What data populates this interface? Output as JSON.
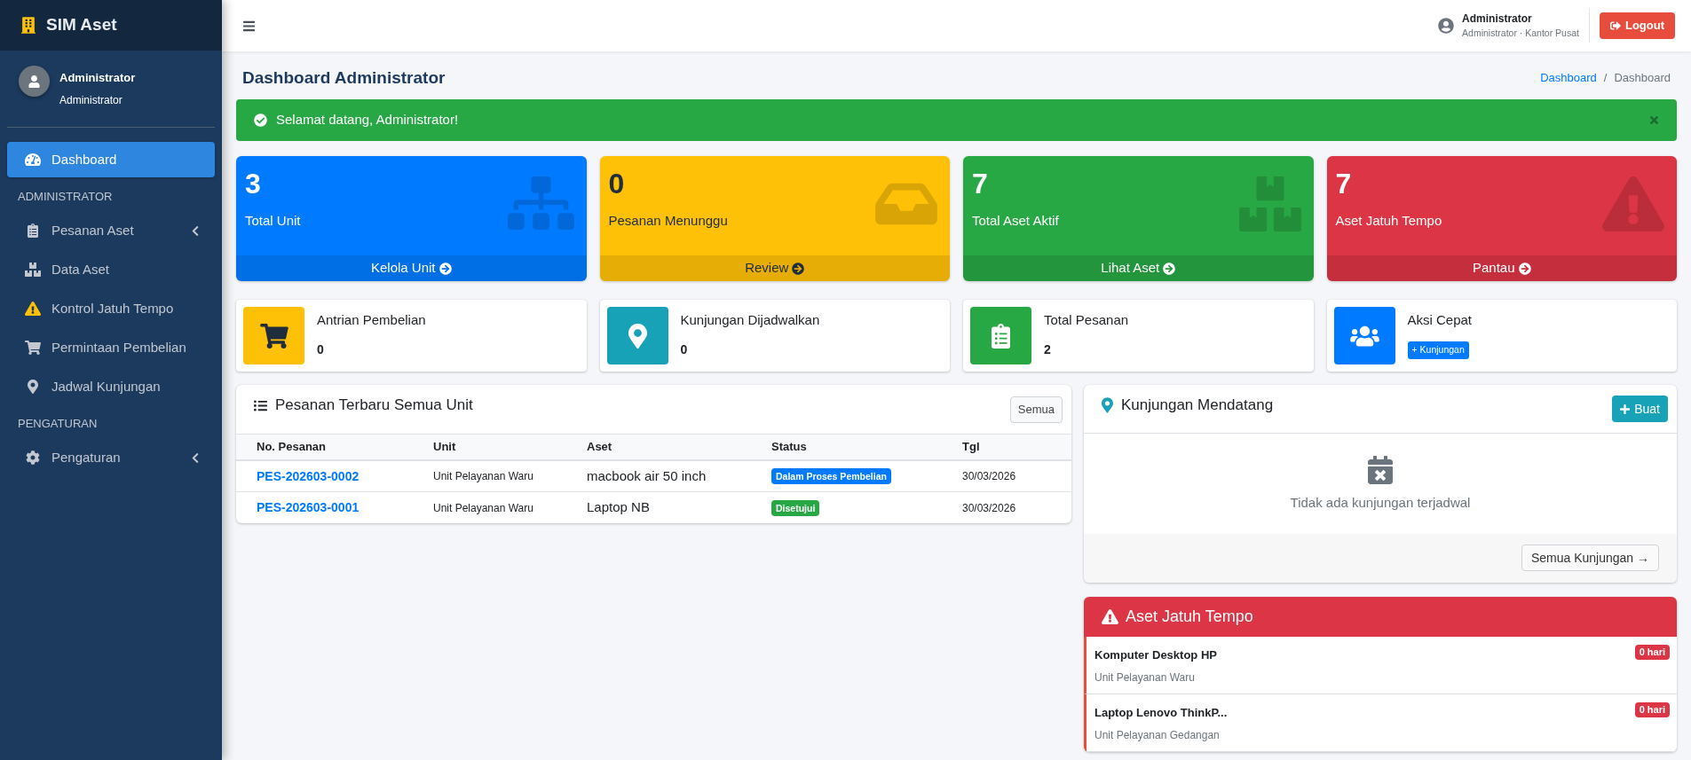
{
  "sidebar": {
    "brand": "SIM Aset",
    "user": {
      "name": "Administrator",
      "role": "Administrator"
    },
    "menu": [
      {
        "kind": "link",
        "label": "Dashboard",
        "selected": true
      },
      {
        "kind": "header",
        "label": "ADMINISTRATOR"
      },
      {
        "kind": "group",
        "label": "Pesanan Aset",
        "selected": false,
        "expanded": false
      },
      {
        "kind": "link",
        "label": "Data Aset",
        "selected": false
      },
      {
        "kind": "link",
        "label": "Kontrol Jatuh Tempo",
        "selected": false
      },
      {
        "kind": "link",
        "label": "Permintaan Pembelian",
        "selected": false
      },
      {
        "kind": "link",
        "label": "Jadwal Kunjungan",
        "selected": false
      },
      {
        "kind": "header",
        "label": "PENGATURAN"
      },
      {
        "kind": "group",
        "label": "Pengaturan",
        "selected": false,
        "expanded": false
      }
    ]
  },
  "topbar": {
    "user": {
      "name": "Administrator",
      "subtitle": "Administrator · Kantor Pusat"
    },
    "logout": "Logout"
  },
  "page_header": {
    "title": "Dashboard Administrator",
    "separator": "/",
    "breadcrumb": [
      {
        "kind": "link",
        "label": "Dashboard"
      },
      {
        "kind": "current",
        "label": "Dashboard"
      }
    ]
  },
  "alert": {
    "message": "Selamat datang, Administrator!"
  },
  "stat_cards": [
    {
      "value": "3",
      "label": "Total Unit",
      "link": "Kelola Unit",
      "color": "#007bff"
    },
    {
      "value": "0",
      "label": "Pesanan Menunggu",
      "link": "Review",
      "color": "#ffc107"
    },
    {
      "value": "7",
      "label": "Total Aset Aktif",
      "link": "Lihat Aset",
      "color": "#28a745"
    },
    {
      "value": "7",
      "label": "Aset Jatuh Tempo",
      "link": "Pantau",
      "color": "#dc3545"
    }
  ],
  "info_boxes": [
    {
      "kind": "count",
      "label": "Antrian Pembelian",
      "value": "0",
      "color": "#ffc107"
    },
    {
      "kind": "count",
      "label": "Kunjungan Dijadwalkan",
      "value": "0",
      "color": "#17a2b8"
    },
    {
      "kind": "count",
      "label": "Total Pesanan",
      "value": "2",
      "color": "#28a745"
    },
    {
      "kind": "action",
      "label": "Aksi Cepat",
      "action": "+ Kunjungan",
      "color": "#007bff"
    }
  ],
  "orders": {
    "title": "Pesanan Terbaru Semua Unit",
    "button": "Semua",
    "columns": [
      "No. Pesanan",
      "Unit",
      "Aset",
      "Status",
      "Tgl"
    ],
    "rows": [
      {
        "no": "PES-202603-0002",
        "unit": "Unit Pelayanan Waru",
        "asset": "macbook air 50 inch",
        "status": {
          "label": "Dalam Proses Pembelian",
          "color": "#007bff"
        },
        "date": "30/03/2026"
      },
      {
        "no": "PES-202603-0001",
        "unit": "Unit Pelayanan Waru",
        "asset": "Laptop NB",
        "status": {
          "label": "Disetujui",
          "color": "#28a745"
        },
        "date": "30/03/2026"
      }
    ]
  },
  "visits": {
    "title": "Kunjungan Mendatang",
    "button": "Buat",
    "empty_message": "Tidak ada kunjungan terjadwal",
    "footer_button": "Semua Kunjungan →"
  },
  "due_assets": {
    "title": "Aset Jatuh Tempo",
    "items": [
      {
        "name": "Komputer Desktop HP",
        "unit": "Unit Pelayanan Waru",
        "badge": "0 hari"
      },
      {
        "name": "Laptop Lenovo ThinkP...",
        "unit": "Unit Pelayanan Gedangan",
        "badge": "0 hari"
      }
    ]
  }
}
